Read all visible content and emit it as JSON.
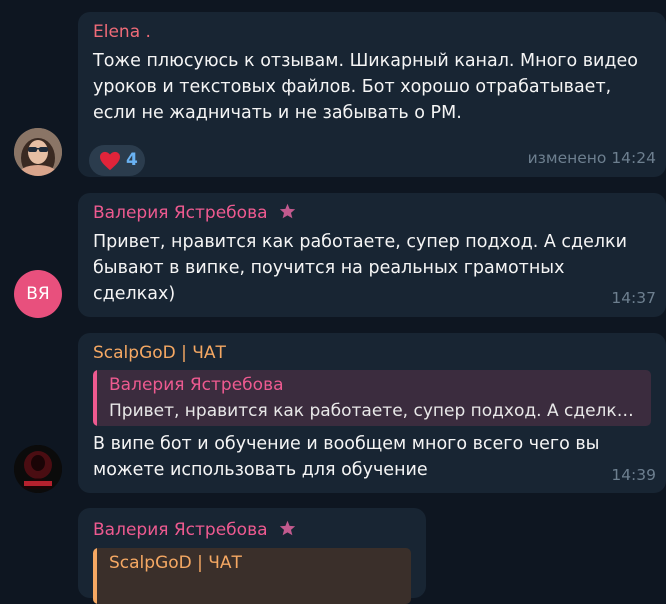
{
  "messages": [
    {
      "sender": "Elena .",
      "sender_color": "#f06b78",
      "text": "Тоже плюсуюсь к отзывам. Шикарный канал. Много видео\nуроков и текстовых файлов. Бот хорошо отрабатывает,\nесли не жадничать и не забывать о РМ.",
      "reaction": {
        "emoji": "heart",
        "count": "4"
      },
      "time": "изменено 14:24"
    },
    {
      "sender": "Валерия Ястребова",
      "sender_color": "#ee5a90",
      "avatar_initials": "ВЯ",
      "avatar_color": "#e8507d",
      "text": "Привет, нравится как работаете, супер подход. А сделки\nбывают в випке, поучится на реальных грамотных\nсделках)",
      "time": "14:37"
    },
    {
      "sender": "ScalpGoD | ЧАТ",
      "sender_color": "#f5a863",
      "reply": {
        "name": "Валерия Ястребова",
        "text": "Привет, нравится как работаете, супер подход. А сделки бывают в випке"
      },
      "text": "В випе бот и обучение и вообщем много всего чего вы\nможете использовать для обучение",
      "time": "14:39"
    },
    {
      "sender": "Валерия Ястребова",
      "sender_color": "#ee5a90",
      "reply": {
        "name": "ScalpGoD | ЧАТ"
      }
    }
  ],
  "colors": {
    "background": "#0e1621",
    "bubble": "#182533",
    "time": "#6d7f8f",
    "reaction_count": "#6ab2f2"
  }
}
